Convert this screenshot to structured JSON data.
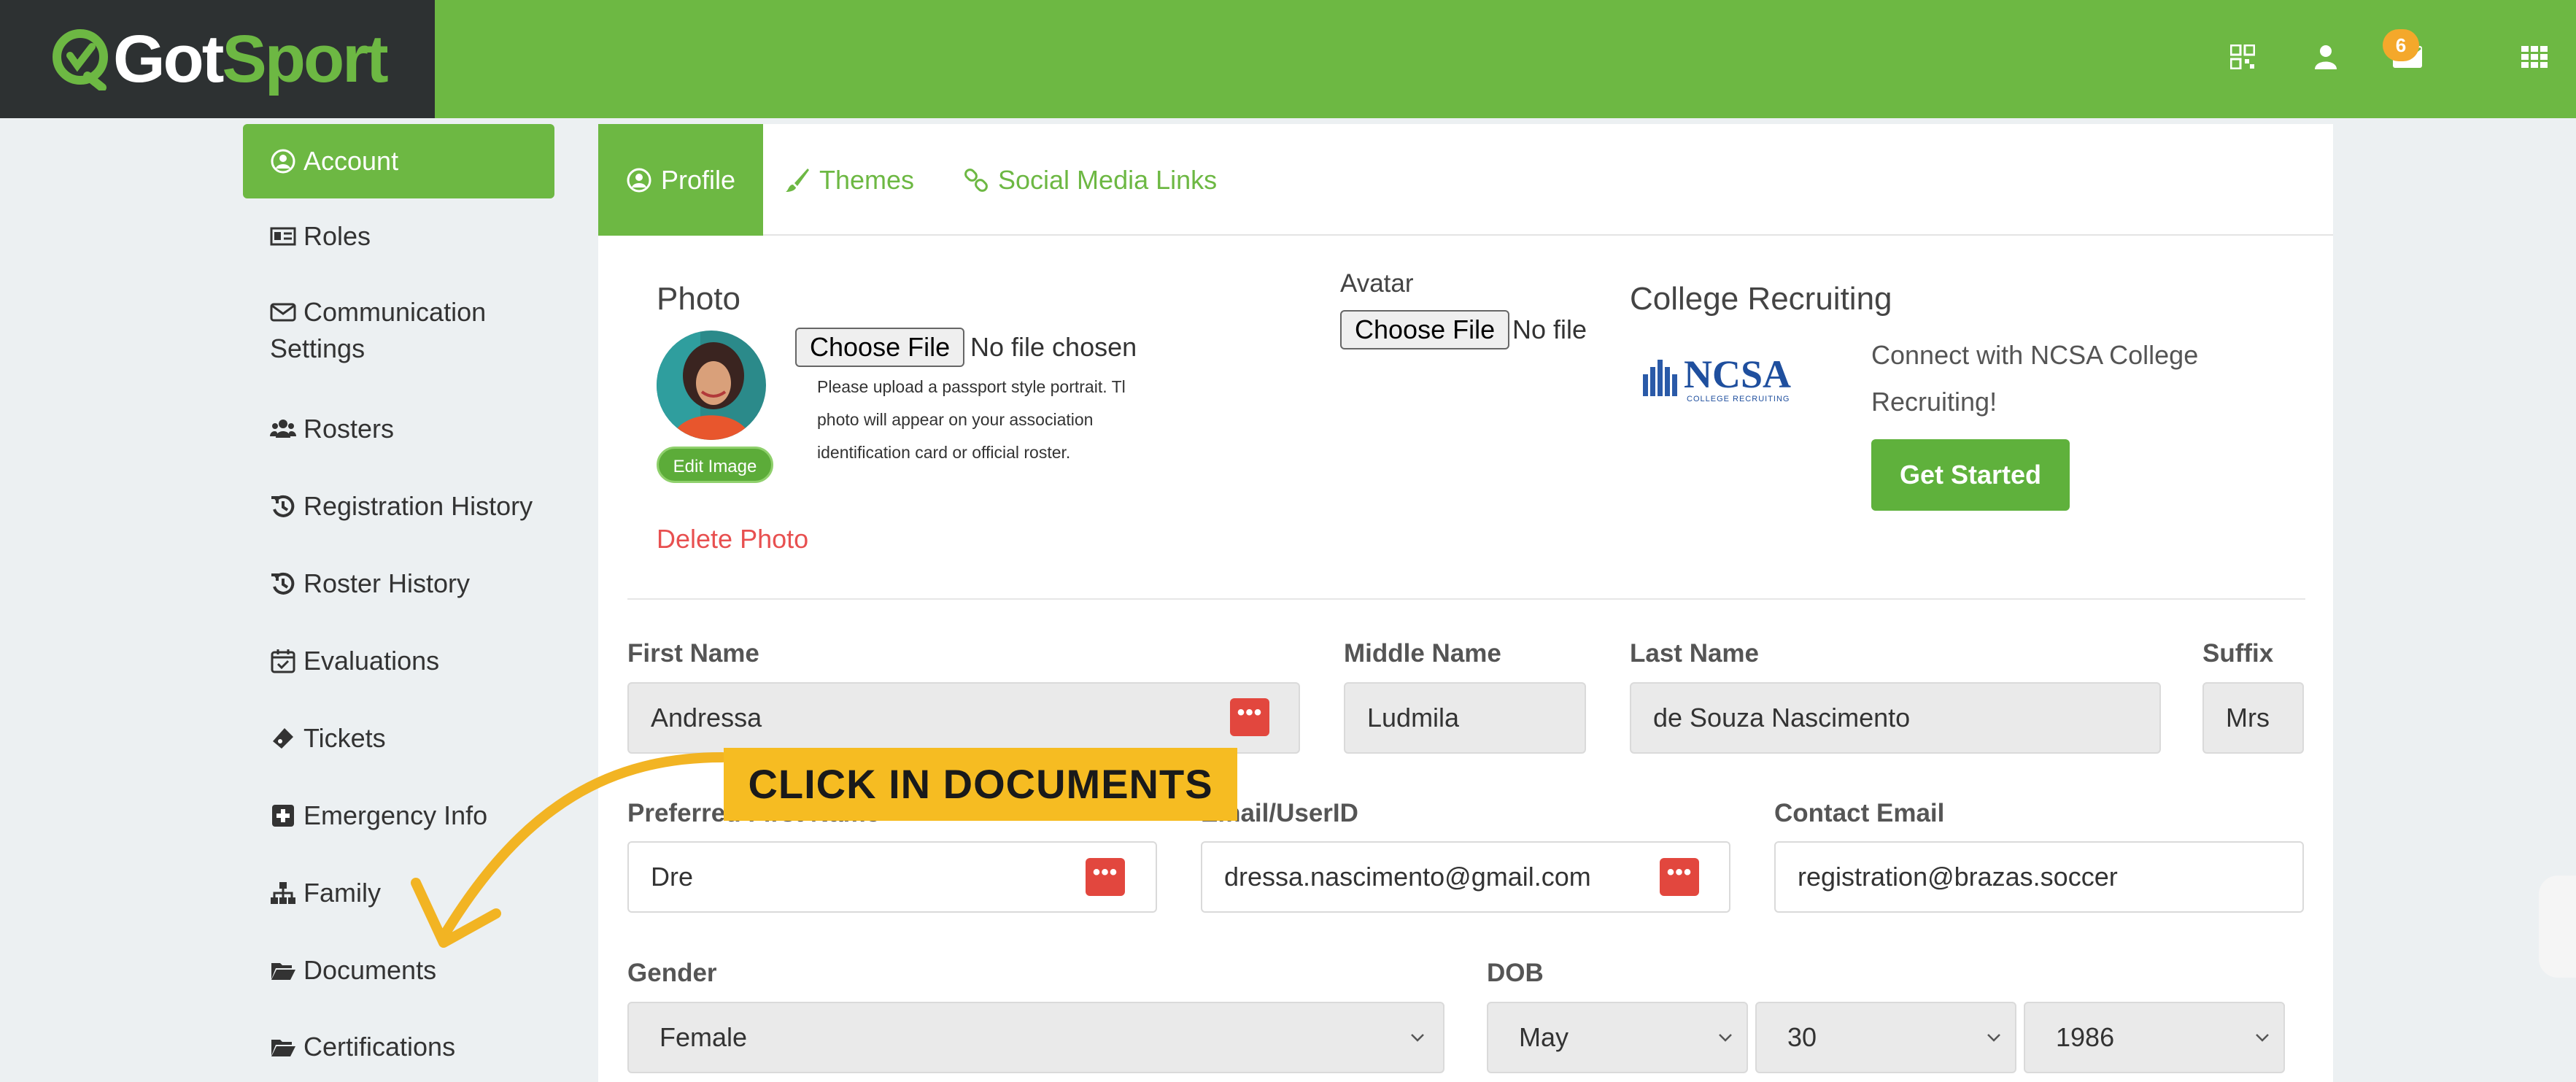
{
  "brand": {
    "got": "Got",
    "sport": "Sport"
  },
  "topbar": {
    "mail_badge": "6"
  },
  "sidebar": {
    "items": [
      {
        "label": "Account"
      },
      {
        "label": "Roles"
      },
      {
        "label": "Communication"
      },
      {
        "label": "Settings"
      },
      {
        "label": "Rosters"
      },
      {
        "label": "Registration History"
      },
      {
        "label": "Roster History"
      },
      {
        "label": "Evaluations"
      },
      {
        "label": "Tickets"
      },
      {
        "label": "Emergency Info"
      },
      {
        "label": "Family"
      },
      {
        "label": "Documents"
      },
      {
        "label": "Certifications"
      }
    ]
  },
  "tabs": [
    {
      "label": "Profile"
    },
    {
      "label": "Themes"
    },
    {
      "label": "Social Media Links"
    }
  ],
  "photo": {
    "title": "Photo",
    "choose_label": "Choose File",
    "no_file": "No file chosen",
    "hint_lines": [
      "Please upload a passport style portrait. Tl",
      "photo will appear on your association",
      "identification card or official roster."
    ],
    "edit_label": "Edit Image",
    "delete_label": "Delete Photo"
  },
  "avatar": {
    "title": "Avatar",
    "choose_label": "Choose File",
    "no_file": "No file"
  },
  "college": {
    "title": "College Recruiting",
    "logo_text": "NCSA",
    "logo_sub": "COLLEGE RECRUITING",
    "text_line1": "Connect with NCSA College",
    "text_line2": "Recruiting!",
    "button_label": "Get Started"
  },
  "form": {
    "first_name": {
      "label": "First Name",
      "value": "Andressa"
    },
    "middle_name": {
      "label": "Middle Name",
      "value": "Ludmila"
    },
    "last_name": {
      "label": "Last Name",
      "value": "de Souza Nascimento"
    },
    "suffix": {
      "label": "Suffix",
      "value": "Mrs"
    },
    "preferred_first_name": {
      "label": "Preferred First Name",
      "value": "Dre"
    },
    "email": {
      "label": "Email/UserID",
      "value": "dressa.nascimento@gmail.com"
    },
    "contact_email": {
      "label": "Contact Email",
      "value": "registration@brazas.soccer"
    },
    "gender": {
      "label": "Gender",
      "value": "Female"
    },
    "dob": {
      "label": "DOB",
      "month": "May",
      "day": "30",
      "year": "1986"
    }
  },
  "annotation": {
    "callout": "CLICK IN DOCUMENTS"
  },
  "colors": {
    "brand_green": "#6db843",
    "dark": "#2d3132",
    "callout": "#f6bc22",
    "danger": "#e2473e",
    "badge": "#f4a82b"
  }
}
